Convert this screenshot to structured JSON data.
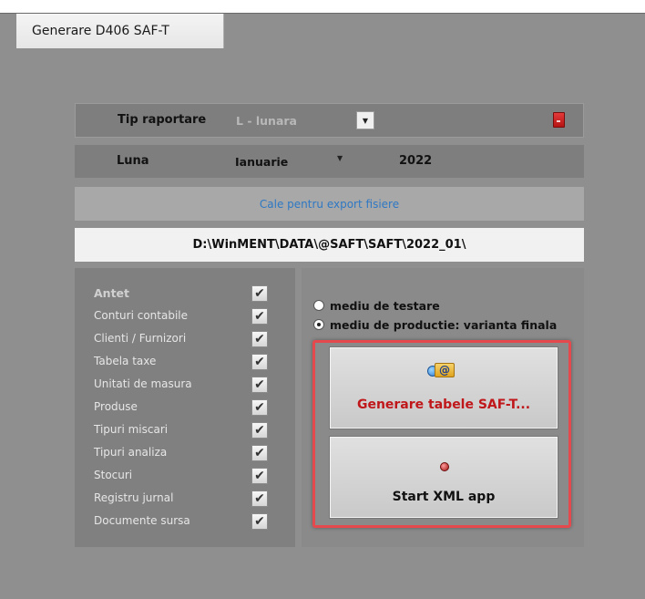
{
  "window": {
    "title": "Generare D406 SAF-T"
  },
  "tip_raportare": {
    "label": "Tip raportare",
    "value": "L - lunara"
  },
  "luna": {
    "label": "Luna",
    "value": "Ianuarie",
    "year": "2022"
  },
  "export": {
    "caption": "Cale pentru export fisiere",
    "path": "D:\\WinMENT\\DATA\\@SAFT\\SAFT\\2022_01\\"
  },
  "sections": [
    {
      "label": "Antet",
      "checked": true
    },
    {
      "label": "Conturi contabile",
      "checked": true
    },
    {
      "label": "Clienti / Furnizori",
      "checked": true
    },
    {
      "label": "Tabela taxe",
      "checked": true
    },
    {
      "label": "Unitati de masura",
      "checked": true
    },
    {
      "label": "Produse",
      "checked": true
    },
    {
      "label": "Tipuri miscari",
      "checked": true
    },
    {
      "label": "Tipuri analiza",
      "checked": true
    },
    {
      "label": "Stocuri",
      "checked": true
    },
    {
      "label": "Registru jurnal",
      "checked": true
    },
    {
      "label": "Documente sursa",
      "checked": true
    }
  ],
  "check_glyph": "✔",
  "environment": {
    "options": [
      {
        "label": "mediu de testare",
        "selected": false
      },
      {
        "label": "mediu de productie: varianta finala",
        "selected": true
      }
    ]
  },
  "buttons": {
    "generate": {
      "label": "Generare tabele SAF-T...",
      "color": "#c0171b",
      "icon": "email-globe-icon"
    },
    "start_xml": {
      "label": "Start XML app",
      "icon": "red-dot-icon"
    }
  },
  "colors": {
    "highlight": "#e5484d",
    "link": "#2e78c4",
    "accent_red": "#c0171b"
  }
}
